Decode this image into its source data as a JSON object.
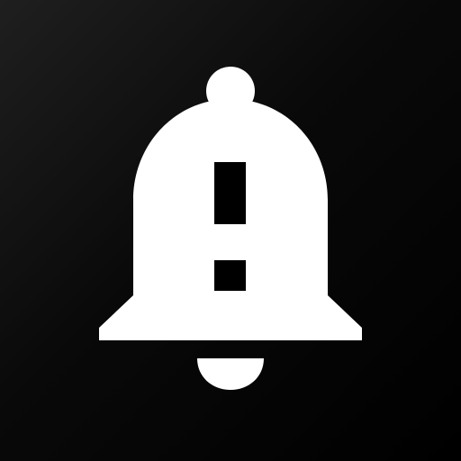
{
  "icon": {
    "name": "bell-alert-icon",
    "background_color": "#000000",
    "foreground_color": "#ffffff",
    "alert_mark_color": "#000000"
  }
}
